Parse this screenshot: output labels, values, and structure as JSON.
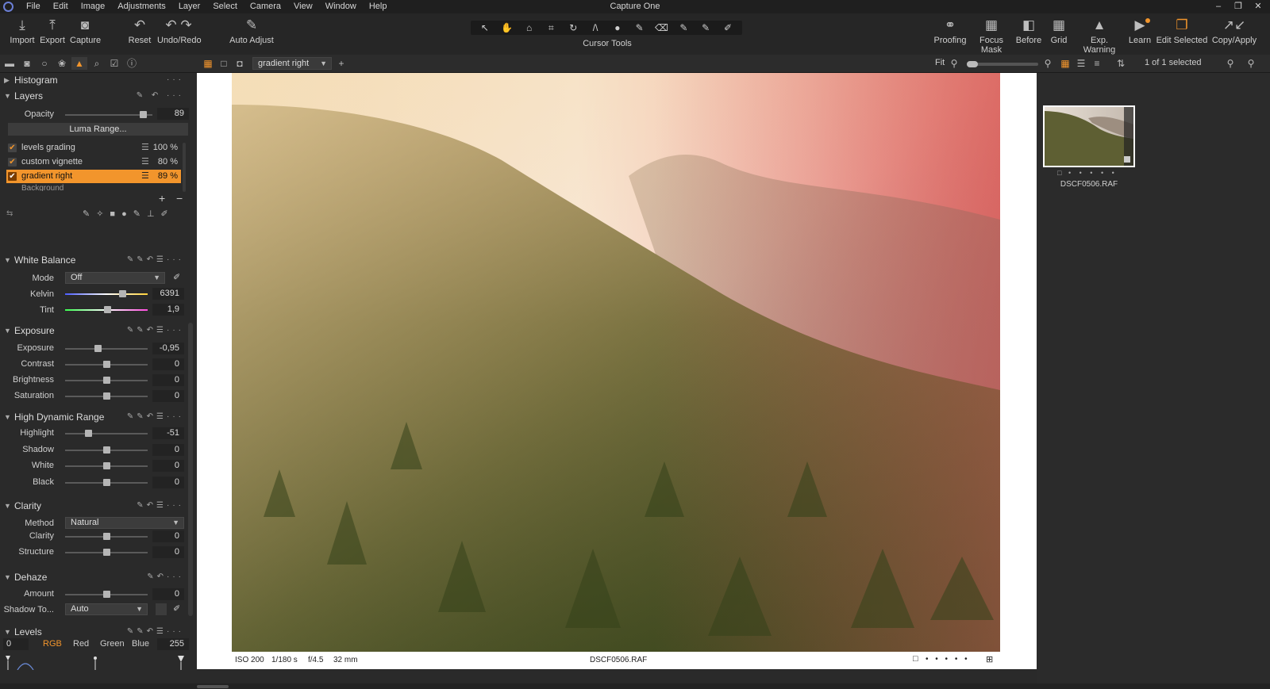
{
  "app": {
    "title": "Capture One"
  },
  "menu": [
    "File",
    "Edit",
    "Image",
    "Adjustments",
    "Layer",
    "Select",
    "Camera",
    "View",
    "Window",
    "Help"
  ],
  "window_controls": [
    "–",
    "❐",
    "✕"
  ],
  "toolbar": {
    "left": [
      {
        "label": "Import",
        "icon": "⤓"
      },
      {
        "label": "Export",
        "icon": "⤒"
      },
      {
        "label": "Capture",
        "icon": "◙"
      },
      {
        "label": "Reset",
        "icon": "↶"
      },
      {
        "label": "Undo/Redo",
        "icon": "↶ ↷"
      },
      {
        "label": "Auto Adjust",
        "icon": "✎"
      }
    ],
    "cursor_tools_label": "Cursor Tools",
    "cursor_tools": [
      "↖",
      "✋",
      "⌂",
      "⌗",
      "↻",
      "/\\",
      "●",
      "✎",
      "⌫",
      "✎",
      "✎",
      "✐"
    ],
    "right": [
      {
        "label": "Proofing",
        "icon": "⚭"
      },
      {
        "label": "Focus Mask",
        "icon": "▦"
      },
      {
        "label": "Before",
        "icon": "◧"
      },
      {
        "label": "Grid",
        "icon": "▦"
      },
      {
        "label": "Exp. Warning",
        "icon": "▲"
      },
      {
        "label": "Learn",
        "icon": "▶"
      },
      {
        "label": "Edit Selected",
        "icon": "❐"
      },
      {
        "label": "Copy/Apply",
        "icon": "↗↙"
      }
    ]
  },
  "subbar": {
    "variant": "gradient right",
    "zoom_label": "Fit",
    "selection": "1 of 1 selected"
  },
  "histogram": {
    "title": "Histogram"
  },
  "layers": {
    "title": "Layers",
    "opacity_label": "Opacity",
    "opacity_value": "89",
    "opacity_level": 0.9,
    "luma_range": "Luma Range...",
    "items": [
      {
        "name": "levels grading",
        "pct": "100 %",
        "selected": false
      },
      {
        "name": "custom vignette",
        "pct": "80 %",
        "selected": false
      },
      {
        "name": "gradient right",
        "pct": "89 %",
        "selected": true
      }
    ],
    "background_item": "Background"
  },
  "white_balance": {
    "title": "White Balance",
    "mode_label": "Mode",
    "mode_value": "Off",
    "kelvin_label": "Kelvin",
    "kelvin_value": "6391",
    "tint_label": "Tint",
    "tint_value": "1,9"
  },
  "exposure": {
    "title": "Exposure",
    "rows": [
      {
        "label": "Exposure",
        "value": "-0,95",
        "level": 0.39
      },
      {
        "label": "Contrast",
        "value": "0",
        "level": 0.5
      },
      {
        "label": "Brightness",
        "value": "0",
        "level": 0.5
      },
      {
        "label": "Saturation",
        "value": "0",
        "level": 0.5
      }
    ]
  },
  "hdr": {
    "title": "High Dynamic Range",
    "rows": [
      {
        "label": "Highlight",
        "value": "-51",
        "level": 0.28
      },
      {
        "label": "Shadow",
        "value": "0",
        "level": 0.5
      },
      {
        "label": "White",
        "value": "0",
        "level": 0.5
      },
      {
        "label": "Black",
        "value": "0",
        "level": 0.5
      }
    ]
  },
  "clarity": {
    "title": "Clarity",
    "method_label": "Method",
    "method_value": "Natural",
    "rows": [
      {
        "label": "Clarity",
        "value": "0",
        "level": 0.5
      },
      {
        "label": "Structure",
        "value": "0",
        "level": 0.5
      }
    ]
  },
  "dehaze": {
    "title": "Dehaze",
    "amount_label": "Amount",
    "amount_value": "0",
    "shadow_label": "Shadow To...",
    "shadow_value": "Auto"
  },
  "levels": {
    "title": "Levels",
    "low": "0",
    "high": "255",
    "channels": [
      "RGB",
      "Red",
      "Green",
      "Blue"
    ]
  },
  "viewer": {
    "iso": "ISO 200",
    "shutter": "1/180 s",
    "aperture": "f/4.5",
    "focal": "32 mm",
    "filename": "DSCF0506.RAF"
  },
  "browser": {
    "thumb_name": "DSCF0506.RAF",
    "rating_dots": "• • • • •"
  },
  "colors": {
    "accent": "#f2952c",
    "panel": "#2a2a2a",
    "viewer_bg": "#ffffff"
  }
}
